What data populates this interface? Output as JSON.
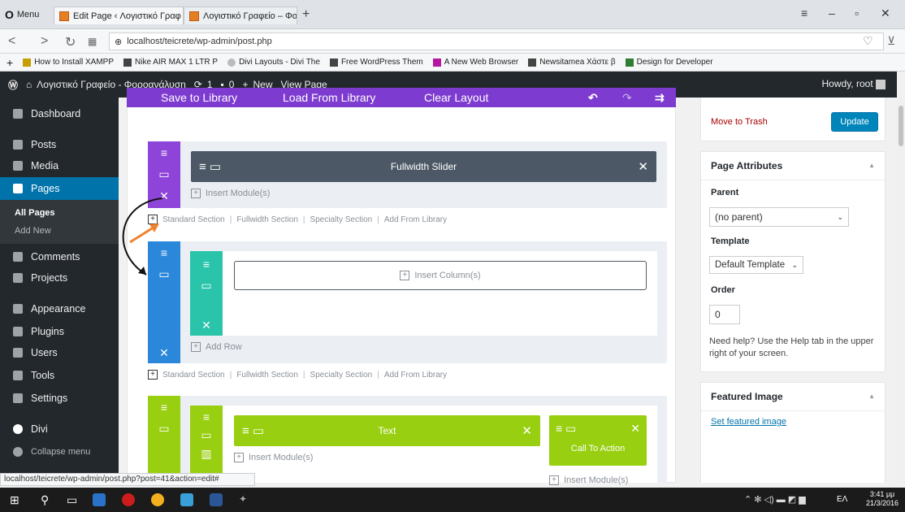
{
  "browser": {
    "menu_label": "Menu",
    "tabs": [
      {
        "label": "Edit Page ‹ Λογιστικό Γραφ",
        "active": true
      },
      {
        "label": "Λογιστικό Γραφείο – Φορο",
        "active": false
      }
    ],
    "url": "localhost/teicrete/wp-admin/post.php",
    "bookmarks": [
      "How to Install XAMPP",
      "Nike AIR MAX 1 LTR P",
      "Divi Layouts - Divi The",
      "Free WordPress Them",
      "A New Web Browser",
      "Newsitamea Χάστε β",
      "Design for Developer"
    ]
  },
  "admin_bar": {
    "site_name": "Λογιστικό Γραφείο - Φοροανάλυση",
    "updates": "1",
    "comments": "0",
    "new_label": "New",
    "view_page": "View Page",
    "howdy": "Howdy, root"
  },
  "sidebar": {
    "items": [
      {
        "label": "Dashboard",
        "icon": "dashboard-icon"
      },
      {
        "label": "Posts",
        "icon": "pin-icon"
      },
      {
        "label": "Media",
        "icon": "media-icon"
      },
      {
        "label": "Pages",
        "icon": "page-icon",
        "active": true
      },
      {
        "label": "Comments",
        "icon": "comment-icon"
      },
      {
        "label": "Projects",
        "icon": "pin-icon"
      },
      {
        "label": "Appearance",
        "icon": "brush-icon"
      },
      {
        "label": "Plugins",
        "icon": "plug-icon"
      },
      {
        "label": "Users",
        "icon": "user-icon"
      },
      {
        "label": "Tools",
        "icon": "wrench-icon"
      },
      {
        "label": "Settings",
        "icon": "settings-icon"
      },
      {
        "label": "Divi",
        "icon": "divi-icon"
      },
      {
        "label": "Collapse menu",
        "icon": "collapse-icon"
      }
    ],
    "sub": {
      "all_pages": "All Pages",
      "add_new": "Add New"
    }
  },
  "builder": {
    "toolbar": {
      "save": "Save to Library",
      "load": "Load From Library",
      "clear": "Clear Layout"
    },
    "section1_module": "Fullwidth Slider",
    "insert_module": "Insert Module(s)",
    "insert_column": "Insert Column(s)",
    "add_row": "Add Row",
    "links": [
      "Standard Section",
      "Fullwidth Section",
      "Specialty Section",
      "Add From Library"
    ],
    "section3_module1": "Text",
    "section3_module2": "Call To Action",
    "colors": {
      "purple": "#8e44d8",
      "slate": "#4c5866",
      "blue": "#2b87da",
      "teal": "#29c4a9",
      "lime": "#98cf10",
      "toolbar": "#7e3bd0"
    }
  },
  "right": {
    "move_trash": "Move to Trash",
    "update": "Update",
    "page_attributes": "Page Attributes",
    "parent_label": "Parent",
    "parent_value": "(no parent)",
    "template_label": "Template",
    "template_value": "Default Template",
    "order_label": "Order",
    "order_value": "0",
    "help_text": "Need help? Use the Help tab in the upper right of your screen.",
    "featured_image": "Featured Image",
    "set_featured": "Set featured image"
  },
  "status_url": "localhost/teicrete/wp-admin/post.php?post=41&action=edit#",
  "taskbar": {
    "lang": "ΕΛ",
    "time": "3:41 μμ",
    "date": "21/3/2016"
  }
}
